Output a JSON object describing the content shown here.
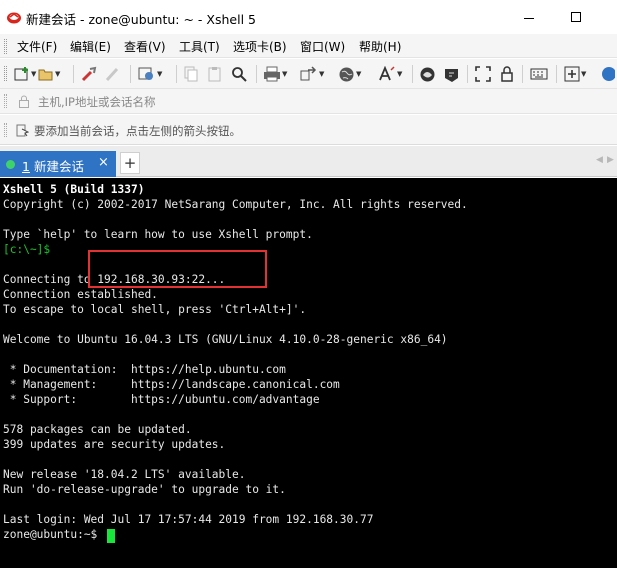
{
  "window": {
    "title": "新建会话 - zone@ubuntu: ~ - Xshell 5",
    "icon": "xshell-logo-icon"
  },
  "menu": {
    "items": [
      "文件(F)",
      "编辑(E)",
      "查看(V)",
      "工具(T)",
      "选项卡(B)",
      "窗口(W)",
      "帮助(H)"
    ]
  },
  "toolbar": {
    "icons": [
      "new-session-icon",
      "open-folder-icon",
      "reconnect-icon",
      "disconnect-icon",
      "properties-icon",
      "copy-icon",
      "paste-icon",
      "find-icon",
      "print-icon",
      "transfer-icon",
      "globe-icon",
      "font-icon",
      "xftp-icon",
      "xshell-icon",
      "fullscreen-icon",
      "lock-icon",
      "keyboard-icon",
      "add-icon",
      "help-icon"
    ]
  },
  "address": {
    "placeholder": "主机,IP地址或会话名称"
  },
  "hint": {
    "text": "要添加当前会话，点击左侧的箭头按钮。"
  },
  "tabs": {
    "active_number": "1",
    "active_label": "新建会话",
    "close_glyph": "×",
    "add_glyph": "+",
    "nav_left": "◀",
    "nav_right": "▶",
    "active_color": "#2f73c5",
    "status_color": "#3ed36a"
  },
  "terminal": {
    "lines": [
      "Xshell 5 (Build 1337)",
      "Copyright (c) 2002-2017 NetSarang Computer, Inc. All rights reserved.",
      "",
      "Type `help' to learn how to use Xshell prompt.",
      "[c:\\~]$",
      "",
      "Connecting to 192.168.30.93:22...",
      "Connection established.",
      "To escape to local shell, press 'Ctrl+Alt+]'.",
      "",
      "Welcome to Ubuntu 16.04.3 LTS (GNU/Linux 4.10.0-28-generic x86_64)",
      "",
      " * Documentation:  https://help.ubuntu.com",
      " * Management:     https://landscape.canonical.com",
      " * Support:        https://ubuntu.com/advantage",
      "",
      "578 packages can be updated.",
      "399 updates are security updates.",
      "",
      "New release '18.04.2 LTS' available.",
      "Run 'do-release-upgrade' to upgrade to it.",
      "",
      "Last login: Wed Jul 17 17:57:44 2019 from 192.168.30.77",
      "zone@ubuntu:~$ "
    ],
    "background": "#000000",
    "prompt_color": "#19c52c",
    "highlight_color": "#e23232"
  }
}
